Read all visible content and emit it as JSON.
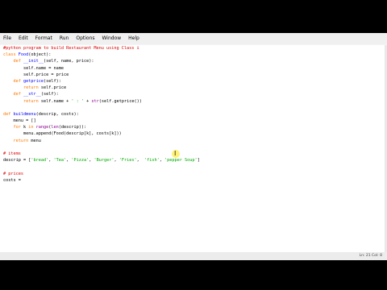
{
  "menubar": {
    "items": [
      "File",
      "Edit",
      "Format",
      "Run",
      "Options",
      "Window",
      "Help"
    ]
  },
  "code": [
    [
      {
        "t": "#python program to build Restaurant Menu using Class i",
        "c": "cm"
      }
    ],
    [
      {
        "t": "class ",
        "c": "kw"
      },
      {
        "t": "Food",
        "c": "df"
      },
      {
        "t": "(object):",
        "c": ""
      }
    ],
    [
      {
        "t": "    def ",
        "c": "kw"
      },
      {
        "t": "__init__",
        "c": "df"
      },
      {
        "t": "(self, name, price):",
        "c": ""
      }
    ],
    [
      {
        "t": "        self.name = name",
        "c": ""
      }
    ],
    [
      {
        "t": "        self.price = price",
        "c": ""
      }
    ],
    [
      {
        "t": "    def ",
        "c": "kw"
      },
      {
        "t": "getprice",
        "c": "df"
      },
      {
        "t": "(self):",
        "c": ""
      }
    ],
    [
      {
        "t": "        return ",
        "c": "kw"
      },
      {
        "t": "self.price",
        "c": ""
      }
    ],
    [
      {
        "t": "    def ",
        "c": "kw"
      },
      {
        "t": "__str__",
        "c": "df"
      },
      {
        "t": "(self):",
        "c": ""
      }
    ],
    [
      {
        "t": "        return ",
        "c": "kw"
      },
      {
        "t": "self.name + ",
        "c": ""
      },
      {
        "t": "' : '",
        "c": "st"
      },
      {
        "t": " + ",
        "c": ""
      },
      {
        "t": "str",
        "c": "bi"
      },
      {
        "t": "(self.getprice())",
        "c": ""
      }
    ],
    [
      {
        "t": "",
        "c": ""
      }
    ],
    [
      {
        "t": "def ",
        "c": "kw"
      },
      {
        "t": "buildmenu",
        "c": "df"
      },
      {
        "t": "(descrip, costs):",
        "c": ""
      }
    ],
    [
      {
        "t": "    menu = []",
        "c": ""
      }
    ],
    [
      {
        "t": "    for ",
        "c": "kw"
      },
      {
        "t": "k ",
        "c": ""
      },
      {
        "t": "in ",
        "c": "kw"
      },
      {
        "t": "range",
        "c": "bi"
      },
      {
        "t": "(",
        "c": ""
      },
      {
        "t": "len",
        "c": "bi"
      },
      {
        "t": "(descrip)):",
        "c": ""
      }
    ],
    [
      {
        "t": "        menu.append(Food(descrip[k], costs[k]))",
        "c": ""
      }
    ],
    [
      {
        "t": "    return ",
        "c": "kw"
      },
      {
        "t": "menu",
        "c": ""
      }
    ],
    [
      {
        "t": "",
        "c": ""
      }
    ],
    [
      {
        "t": "# items",
        "c": "cm"
      }
    ],
    [
      {
        "t": "descrip = [",
        "c": ""
      },
      {
        "t": "'bread'",
        "c": "st"
      },
      {
        "t": ", ",
        "c": ""
      },
      {
        "t": "'Tea'",
        "c": "st"
      },
      {
        "t": ", ",
        "c": ""
      },
      {
        "t": "'Pizza'",
        "c": "st"
      },
      {
        "t": ", ",
        "c": ""
      },
      {
        "t": "'Burger'",
        "c": "st"
      },
      {
        "t": ", ",
        "c": ""
      },
      {
        "t": "'Fries'",
        "c": "st"
      },
      {
        "t": ",  ",
        "c": ""
      },
      {
        "t": "'fish'",
        "c": "st"
      },
      {
        "t": ", ",
        "c": ""
      },
      {
        "t": "'pepper Soup'",
        "c": "st"
      },
      {
        "t": "]",
        "c": ""
      }
    ],
    [
      {
        "t": "",
        "c": ""
      }
    ],
    [
      {
        "t": "# prices",
        "c": "cm"
      }
    ],
    [
      {
        "t": "costs = ",
        "c": ""
      }
    ]
  ],
  "status": {
    "text": "Ln: 21   Col: 8"
  },
  "cursor": {
    "glyph": "I"
  }
}
